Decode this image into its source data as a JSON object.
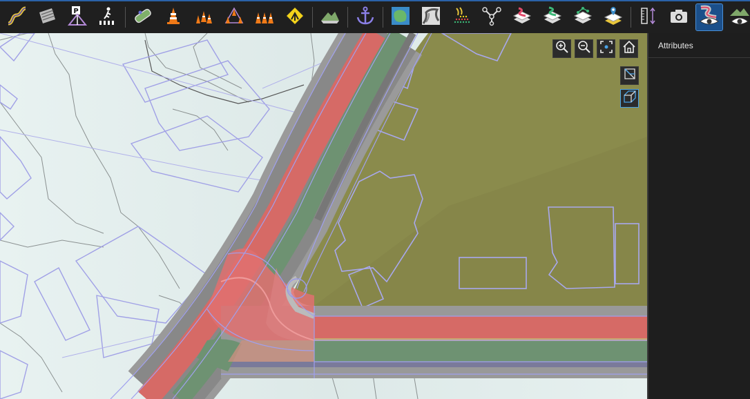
{
  "toolbar": {
    "tools": [
      {
        "name": "road-tool",
        "icon": "road-curve-icon"
      },
      {
        "name": "surface-tool",
        "icon": "surface-stripes-icon"
      },
      {
        "name": "parking-tool",
        "icon": "parking-icon"
      },
      {
        "name": "crosswalk-tool",
        "icon": "crosswalk-icon"
      },
      {
        "name": "sidewalk-tool",
        "icon": "sidewalk-icon"
      },
      {
        "name": "cone-tool",
        "icon": "traffic-cone-icon"
      },
      {
        "name": "cone-row-tool",
        "icon": "cone-row-icon"
      },
      {
        "name": "cone-group-tool",
        "icon": "cone-group-icon"
      },
      {
        "name": "cone-line-tool",
        "icon": "cone-line-icon"
      },
      {
        "name": "sign-tool",
        "icon": "warning-sign-icon"
      },
      {
        "name": "terrain-tool",
        "icon": "terrain-icon"
      },
      {
        "name": "anchor-tool",
        "icon": "anchor-icon"
      },
      {
        "name": "area-tool",
        "icon": "area-map-icon"
      },
      {
        "name": "heightmap-tool",
        "icon": "heightmap-icon"
      },
      {
        "name": "point-cloud-tool",
        "icon": "point-cloud-icon"
      },
      {
        "name": "junction-tool",
        "icon": "junction-icon"
      },
      {
        "name": "road-layers-tool",
        "icon": "road-layers-icon"
      },
      {
        "name": "lane-layers-tool",
        "icon": "lane-layers-icon"
      },
      {
        "name": "point-layers-tool",
        "icon": "point-layers-icon"
      },
      {
        "name": "marker-layers-tool",
        "icon": "marker-layers-icon"
      },
      {
        "name": "measure-tool",
        "icon": "measure-icon"
      },
      {
        "name": "camera-tool",
        "icon": "camera-icon"
      },
      {
        "name": "road-visibility-tool",
        "icon": "road-eye-icon",
        "active": true
      },
      {
        "name": "terrain-visibility-tool",
        "icon": "terrain-eye-icon"
      }
    ]
  },
  "panel": {
    "title": "Attributes"
  },
  "colors": {
    "accent": "#2a62a8",
    "ground": "#8a8b4c",
    "background": "#e4efee",
    "road_shoulder": "#9a9a9a",
    "lane_red": "#d06060",
    "lane_green": "#6a9070",
    "outline": "#9a9ae6"
  }
}
